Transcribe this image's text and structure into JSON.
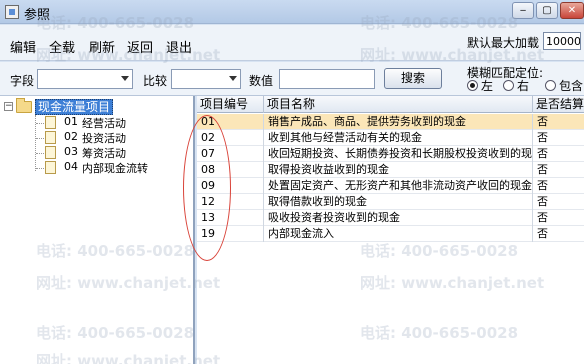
{
  "window": {
    "title": "参照",
    "icon": "app-icon",
    "min": "‒",
    "max": "▢",
    "close": "✕"
  },
  "menu": {
    "edit": "编辑",
    "all": "全载",
    "refresh": "刷新",
    "back": "返回",
    "exit": "退出"
  },
  "max_load": {
    "label": "默认最大加载",
    "value": "10000"
  },
  "filter": {
    "field_label": "字段",
    "field_value": "",
    "compare_label": "比较",
    "compare_value": "",
    "value_label": "数值",
    "value_value": "",
    "search_button": "搜索",
    "fuzzy_label": "模糊匹配定位:",
    "options": {
      "left": "左",
      "right": "右",
      "contain": "包含"
    },
    "selected_option": "left"
  },
  "tree": {
    "root": "现金流量项目",
    "children": [
      {
        "code": "01",
        "label": "经营活动"
      },
      {
        "code": "02",
        "label": "投资活动"
      },
      {
        "code": "03",
        "label": "筹资活动"
      },
      {
        "code": "04",
        "label": "内部现金流转"
      }
    ]
  },
  "grid": {
    "headers": {
      "code": "项目编号",
      "name": "项目名称",
      "settle": "是否结算"
    },
    "rows": [
      {
        "code": "01",
        "name": "销售产成品、商品、提供劳务收到的现金",
        "settle": "否"
      },
      {
        "code": "02",
        "name": "收到其他与经营活动有关的现金",
        "settle": "否"
      },
      {
        "code": "07",
        "name": "收回短期投资、长期债券投资和长期股权投资收到的现金",
        "settle": "否"
      },
      {
        "code": "08",
        "name": "取得投资收益收到的现金",
        "settle": "否"
      },
      {
        "code": "09",
        "name": "处置固定资产、无形资产和其他非流动资产收回的现金净额",
        "settle": "否"
      },
      {
        "code": "12",
        "name": "取得借款收到的现金",
        "settle": "否"
      },
      {
        "code": "13",
        "name": "吸收投资者投资收到的现金",
        "settle": "否"
      },
      {
        "code": "19",
        "name": "内部现金流入",
        "settle": "否"
      }
    ],
    "selected_row": 0
  },
  "watermark": {
    "phone": "电话: 400-665-0028",
    "site": "网址: www.chanjet.net"
  }
}
